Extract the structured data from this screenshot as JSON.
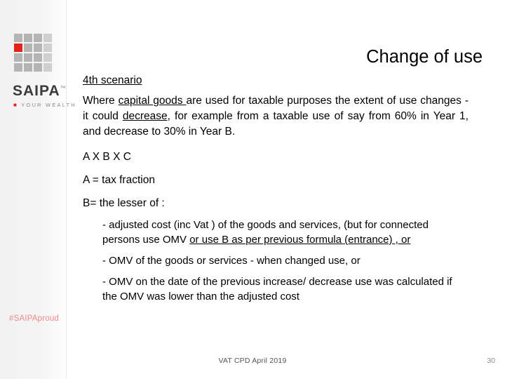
{
  "slide": {
    "title": "Change of use",
    "sidebar": {
      "logo_word": "SAIPA",
      "logo_trademark": "™",
      "logo_tagline": "YOUR WEALTH",
      "hashtag": "#SAIPAproud",
      "logo_grid_accent_color": "#e2231a"
    },
    "body": {
      "scenario_heading": "4th scenario",
      "paragraph_1": {
        "segments": [
          {
            "text": "Where  ",
            "style": "plain"
          },
          {
            "text": "capital  goods ",
            "style": "underline"
          },
          {
            "text": " are  used  for  taxable  purposes  the  extent of use changes  - it could ",
            "style": "plain"
          },
          {
            "text": "decrease,",
            "style": "underline"
          },
          {
            "text": " for example from a taxable use of say from 60% in Year 1, and decrease to 30% in Year B.",
            "style": "plain"
          }
        ]
      },
      "formula": "A X B X C",
      "a_definition": "A = tax fraction",
      "b_definition": "B= the lesser of :",
      "bullets": [
        {
          "segments": [
            {
              "text": "- adjusted cost (inc Vat ) of the goods and services, (but for connected persons  use OMV ",
              "style": "plain"
            },
            {
              "text": "or use B as per previous formula (entrance) , or",
              "style": "underline"
            }
          ]
        },
        {
          "segments": [
            {
              "text": "- OMV    of the goods or services  - when changed use, or",
              "style": "plain"
            }
          ]
        },
        {
          "segments": [
            {
              "text": "- OMV on the date of the previous increase/ decrease use was calculated if the OMV was lower than the adjusted cost",
              "style": "plain"
            }
          ]
        }
      ]
    },
    "footer": {
      "note": "VAT CPD April 2019",
      "page_number": "30"
    }
  }
}
